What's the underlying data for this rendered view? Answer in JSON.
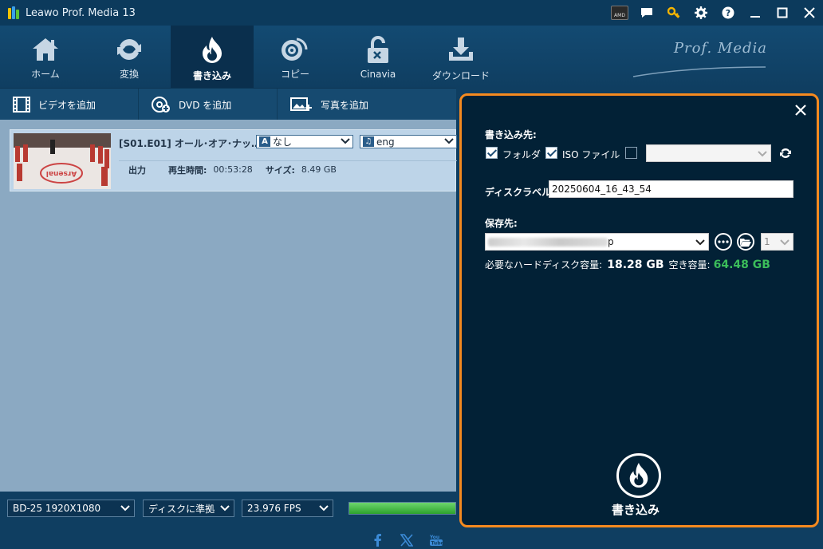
{
  "app": {
    "title": "Leawo Prof. Media 13",
    "brand": "Prof. Media",
    "amd_badge": "AMD"
  },
  "nav": {
    "items": [
      {
        "label": "ホーム",
        "icon": "home-icon"
      },
      {
        "label": "変換",
        "icon": "refresh-icon"
      },
      {
        "label": "書き込み",
        "icon": "flame-icon",
        "active": true
      },
      {
        "label": "コピー",
        "icon": "disc-icon"
      },
      {
        "label": "Cinavia",
        "icon": "unlock-icon"
      },
      {
        "label": "ダウンロード",
        "icon": "download-icon"
      }
    ]
  },
  "toolbar": {
    "add_video": "ビデオを追加",
    "add_dvd": "DVD を追加",
    "add_photo": "写真を追加"
  },
  "file": {
    "title": "[S01.E01] オール･オア･ナッ…",
    "subtitle": "なし",
    "audio": "eng",
    "output_label": "出力",
    "duration_label": "再生時間:",
    "duration": "00:53:28",
    "size_label": "サイズ:",
    "size": "8.49 GB"
  },
  "bottom": {
    "disc_type": "BD-25 1920X1080",
    "aspect": "ディスクに準拠",
    "fps": "23.976 FPS",
    "progress": 1.0
  },
  "panel": {
    "target_label": "書き込み先:",
    "folder_label": "フォルダ",
    "folder_checked": true,
    "iso_label": "ISO ファイル",
    "iso_checked": true,
    "drive_checked": false,
    "disc_label_label": "ディスクラベル:",
    "disc_label": "20250604_16_43_54",
    "save_label": "保存先:",
    "save_path_suffix": "p",
    "copies": "1",
    "required_label": "必要なハードディスク容量:",
    "required": "18.28 GB",
    "free_label": "空き容量:",
    "free": "64.48 GB",
    "burn_label": "書き込み"
  },
  "colors": {
    "accent": "#f58a1f",
    "free_green": "#3bbd5a"
  }
}
